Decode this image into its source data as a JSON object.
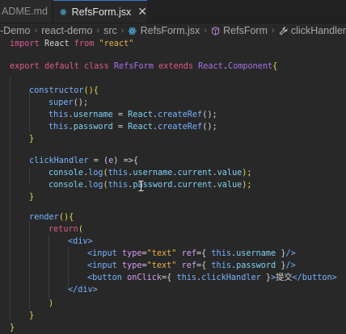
{
  "tabs": [
    {
      "label": "ADME.md"
    },
    {
      "label": "RefsForm.jsx"
    }
  ],
  "breadcrumb": {
    "items": [
      "-Demo",
      "react-demo",
      "src",
      "RefsForm.jsx",
      "RefsForm",
      "clickHandler"
    ]
  },
  "code": {
    "l1": {
      "a": "import",
      "b": "React",
      "c": "from",
      "d": "\"react\""
    },
    "l2": {
      "a": "export",
      "b": "default",
      "c": "class",
      "d": "RefsForm",
      "e": "extends",
      "f": "React",
      "g": ".",
      "h": "Component",
      "i": "{"
    },
    "l3": {
      "a": "constructor",
      "b": "(){"
    },
    "l4": {
      "a": "super",
      "b": "();"
    },
    "l5": {
      "a": "this",
      "b": ".",
      "c": "username",
      "d": " = ",
      "e": "React",
      "f": ".",
      "g": "createRef",
      "h": "();"
    },
    "l6": {
      "a": "this",
      "b": ".",
      "c": "password",
      "d": " = ",
      "e": "React",
      "f": ".",
      "g": "createRef",
      "h": "();"
    },
    "l7": {
      "a": "}"
    },
    "l8": {
      "a": "clickHandler",
      "b": " = (",
      "c": "e",
      "d": ") =>{"
    },
    "l9": {
      "a": "console",
      "b": ".",
      "c": "log",
      "d": "(",
      "e": "this",
      "f": ".",
      "g": "username",
      "h": ".",
      "i": "current",
      "j": ".",
      "k": "value",
      "l": ");"
    },
    "l10": {
      "a": "console",
      "b": ".",
      "c": "log",
      "d": "(",
      "e": "this",
      "f": ".",
      "g": "password",
      "h": ".",
      "i": "current",
      "j": ".",
      "k": "value",
      "l": ");"
    },
    "l11": {
      "a": "}"
    },
    "l12": {
      "a": "render",
      "b": "(){"
    },
    "l13": {
      "a": "return",
      "b": "("
    },
    "l14": {
      "a": "<div>"
    },
    "l15": {
      "a": "<input",
      "b": "type",
      "c": "=",
      "d": "\"text\"",
      "e": "ref",
      "f": "={",
      "g": "this",
      "h": ".",
      "i": "username",
      "j": " }",
      "k": "/>"
    },
    "l16": {
      "a": "<input",
      "b": "type",
      "c": "=",
      "d": "\"text\"",
      "e": "ref",
      "f": "={",
      "g": "this",
      "h": ".",
      "i": "password",
      "j": " }",
      "k": "/>"
    },
    "l17": {
      "a": "<button",
      "b": "onClick",
      "c": "={",
      "d": "this",
      "e": ".",
      "f": "clickHandler",
      "g": " }",
      "h": ">",
      "i": "提交",
      "j": "</button>"
    },
    "l18": {
      "a": "</div>"
    },
    "l19": {
      "a": ")"
    },
    "l20": {
      "a": "}"
    },
    "l21": {
      "a": "}"
    }
  },
  "colors": {
    "background": "#282828",
    "keyword": "#e05a8f",
    "string": "#e8b04b",
    "class": "#a872e6",
    "function": "#78b3ff",
    "property": "#7fd1f2"
  },
  "icons": [
    "react-icon",
    "close-icon",
    "chevron-right-icon",
    "wrench-icon",
    "text-cursor-icon"
  ]
}
